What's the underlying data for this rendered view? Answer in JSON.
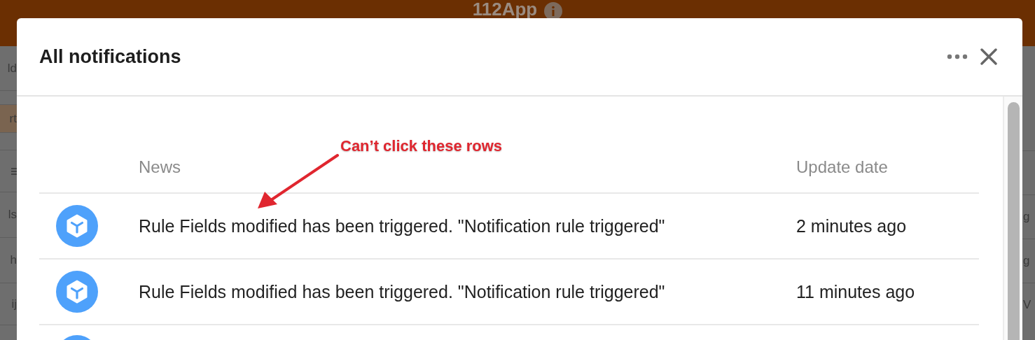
{
  "background_app": {
    "title": "112App",
    "left_fragments": [
      {
        "text": "ld",
        "kind": "plain"
      },
      {
        "text": "rt",
        "kind": "highlight"
      },
      {
        "kind": "icon"
      },
      {
        "text": "ls",
        "kind": "plain"
      },
      {
        "text": "h",
        "kind": "plain"
      },
      {
        "text": "ij",
        "kind": "plain"
      }
    ],
    "right_fragments": [
      "g",
      "g",
      "V"
    ]
  },
  "dialog": {
    "title": "All notifications",
    "table": {
      "columns": [
        "News",
        "Update date"
      ],
      "rows": [
        {
          "kind": "full",
          "news": "Rule Fields modified has been triggered. \"Notification rule triggered\"",
          "date": "2 minutes ago"
        },
        {
          "kind": "full",
          "news": "Rule Fields modified has been triggered. \"Notification rule triggered\"",
          "date": "11 minutes ago"
        },
        {
          "kind": "partial"
        }
      ]
    }
  },
  "annotation": {
    "text": "Can’t click these rows"
  }
}
